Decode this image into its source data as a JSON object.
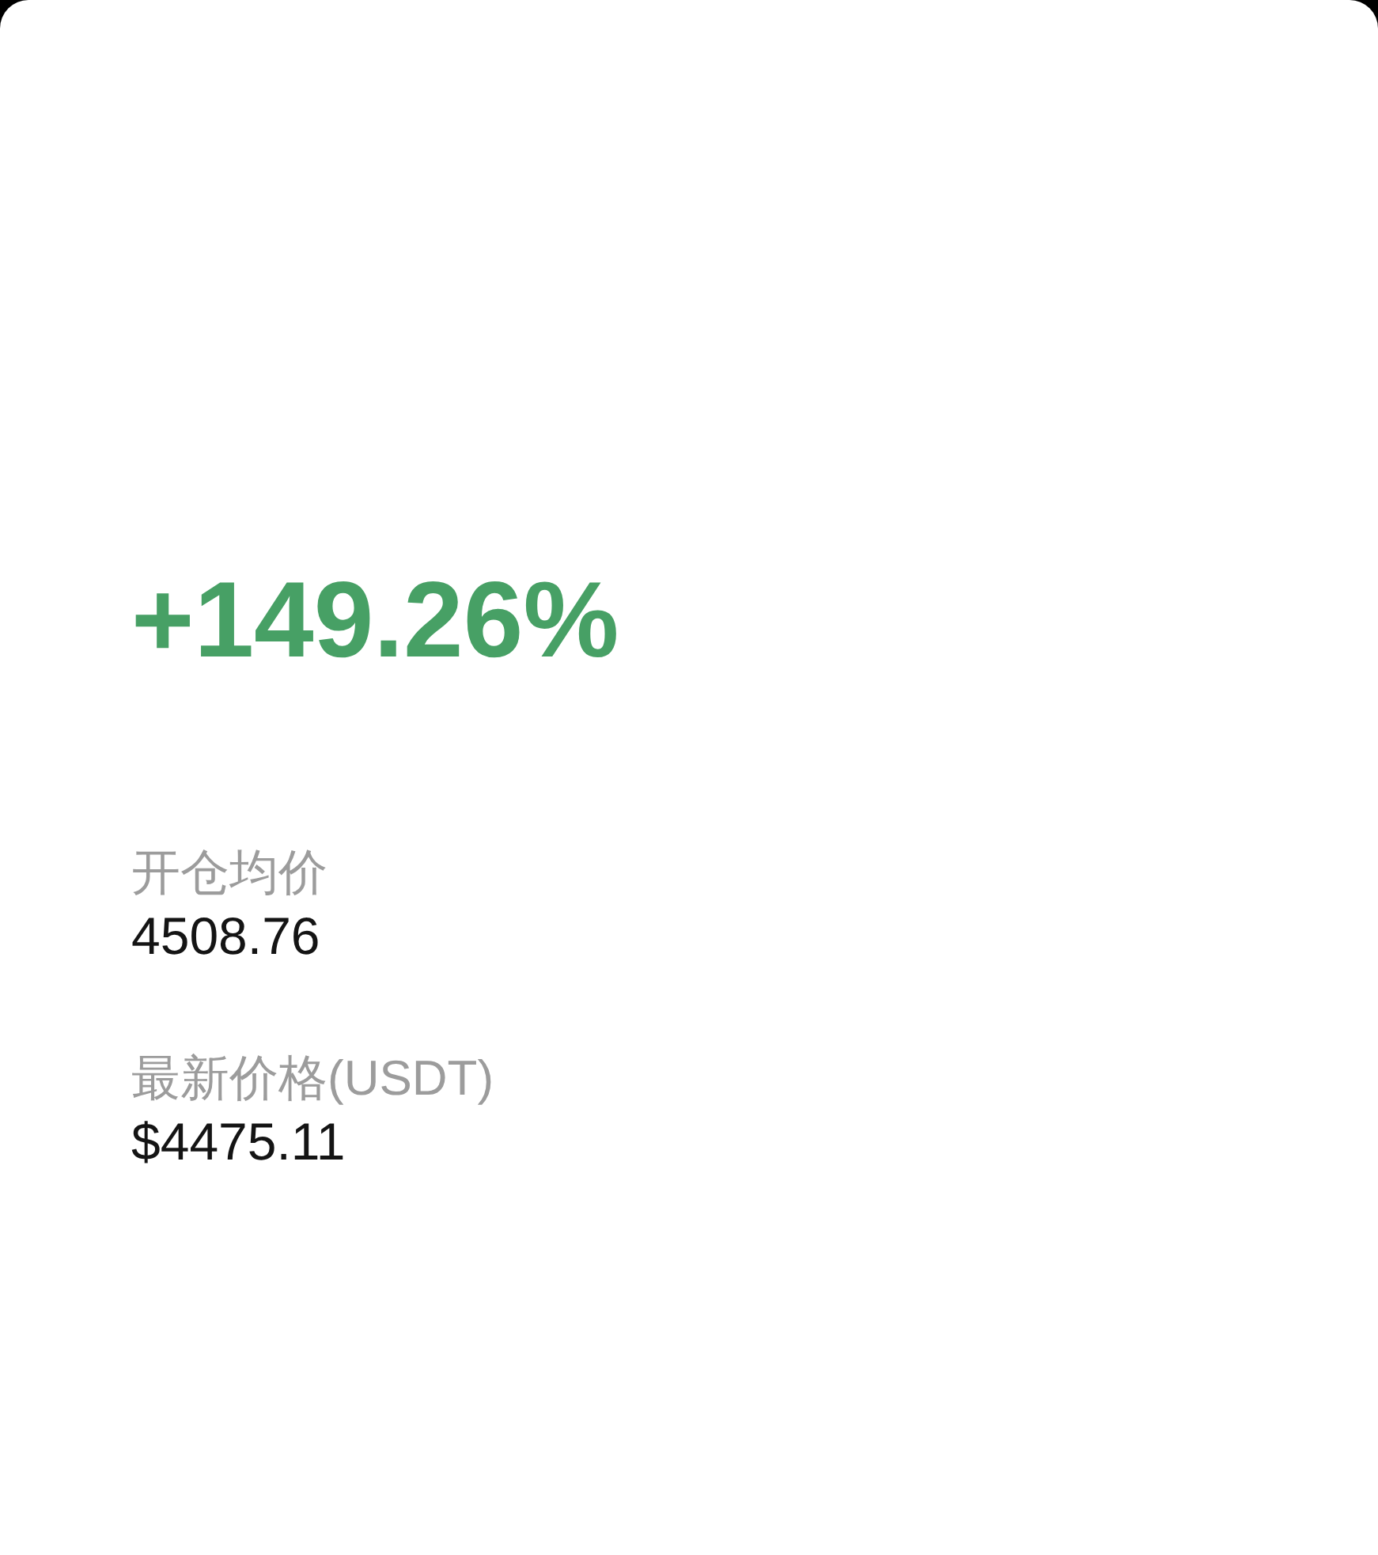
{
  "change": {
    "value": "+149.26%"
  },
  "fields": [
    {
      "label": "开仓均价",
      "value": "4508.76"
    },
    {
      "label": "最新价格(USDT)",
      "value": "$4475.11"
    }
  ]
}
